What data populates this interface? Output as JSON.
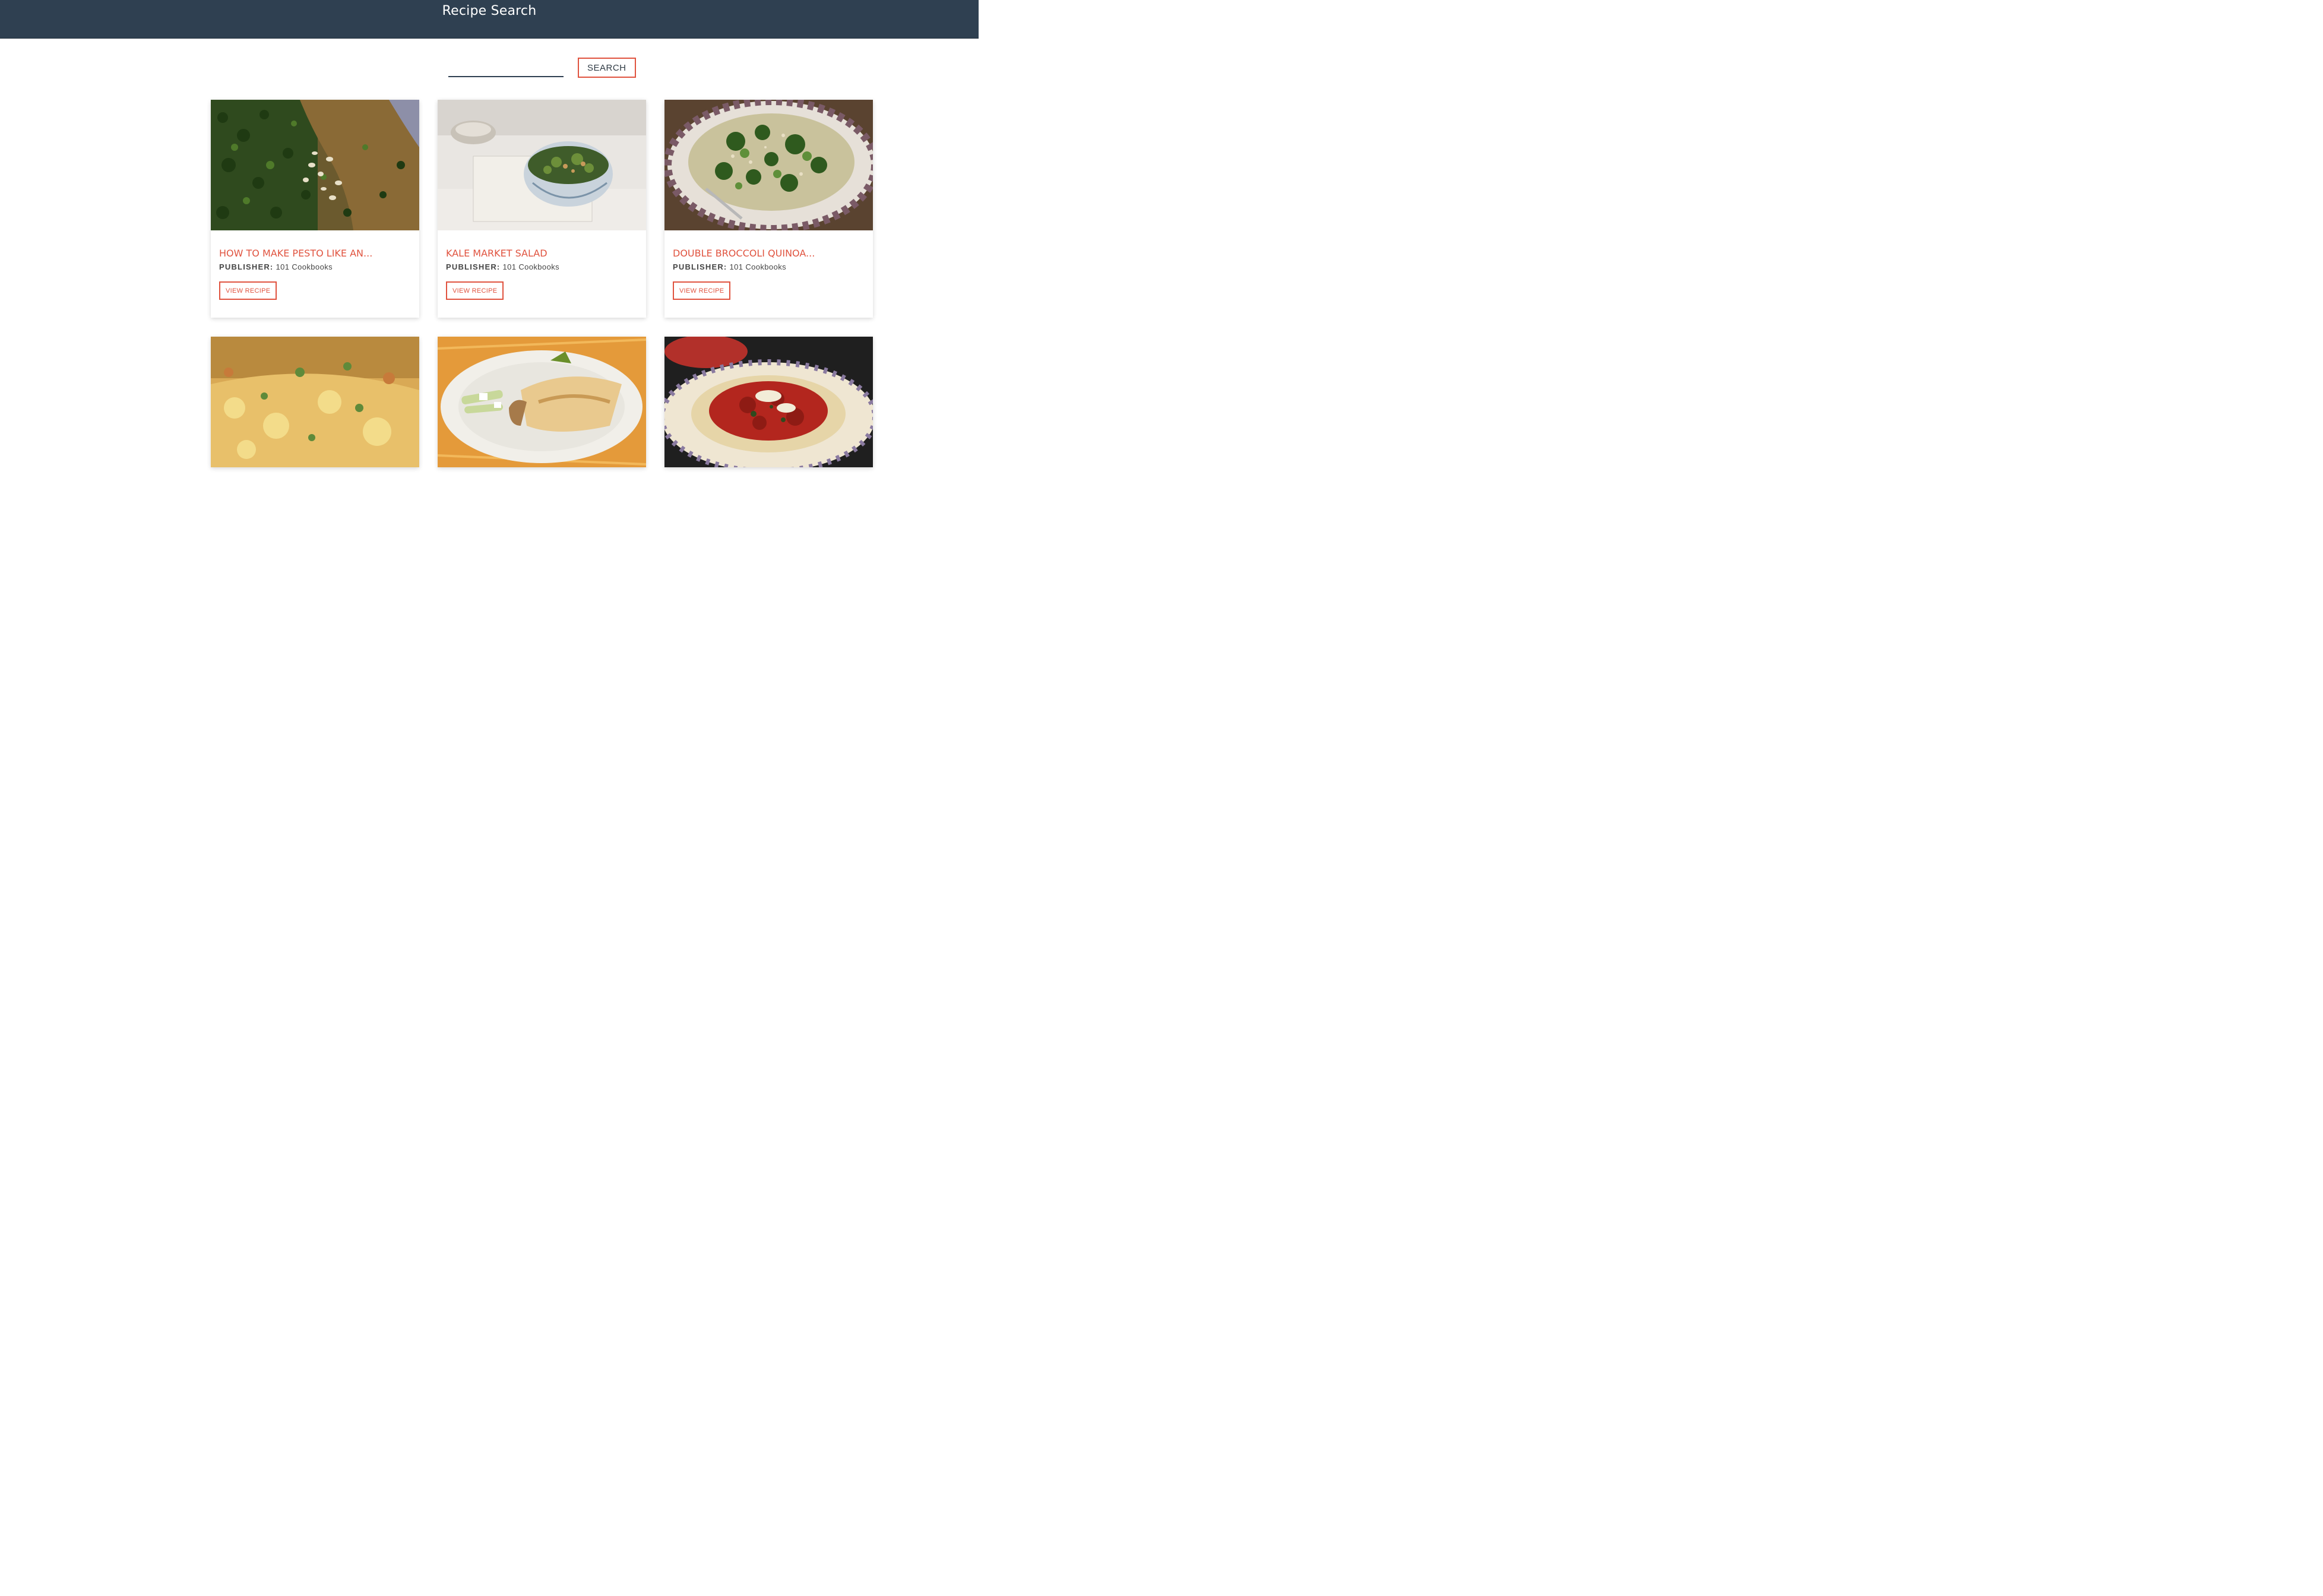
{
  "header": {
    "title": "Recipe Search"
  },
  "search": {
    "value": "",
    "placeholder": "",
    "button_label": "SEARCH"
  },
  "colors": {
    "header_bg": "#2f4051",
    "accent": "#e0533f"
  },
  "recipes": [
    {
      "title": "HOW TO MAKE PESTO LIKE AN...",
      "publisher_label": "PUBLISHER:",
      "publisher": "101 Cookbooks",
      "button_label": "VIEW RECIPE",
      "image_icon": "pesto-image"
    },
    {
      "title": "KALE MARKET SALAD",
      "publisher_label": "PUBLISHER:",
      "publisher": "101 Cookbooks",
      "button_label": "VIEW RECIPE",
      "image_icon": "salad-bowl-image"
    },
    {
      "title": "DOUBLE BROCCOLI QUINOA...",
      "publisher_label": "PUBLISHER:",
      "publisher": "101 Cookbooks",
      "button_label": "VIEW RECIPE",
      "image_icon": "broccoli-quinoa-image"
    },
    {
      "title": "",
      "image_icon": "frittata-image"
    },
    {
      "title": "",
      "image_icon": "burrito-plate-image"
    },
    {
      "title": "",
      "image_icon": "chicken-parmesan-image"
    }
  ]
}
